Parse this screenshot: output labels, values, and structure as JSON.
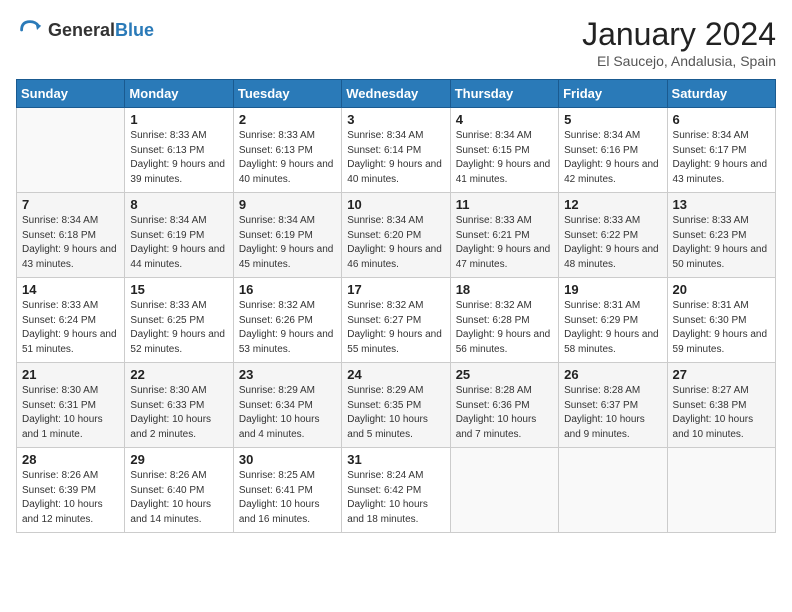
{
  "header": {
    "logo_general": "General",
    "logo_blue": "Blue",
    "month_title": "January 2024",
    "location": "El Saucejo, Andalusia, Spain"
  },
  "weekdays": [
    "Sunday",
    "Monday",
    "Tuesday",
    "Wednesday",
    "Thursday",
    "Friday",
    "Saturday"
  ],
  "weeks": [
    [
      {
        "day": "",
        "sunrise": "",
        "sunset": "",
        "daylight": ""
      },
      {
        "day": "1",
        "sunrise": "Sunrise: 8:33 AM",
        "sunset": "Sunset: 6:13 PM",
        "daylight": "Daylight: 9 hours and 39 minutes."
      },
      {
        "day": "2",
        "sunrise": "Sunrise: 8:33 AM",
        "sunset": "Sunset: 6:13 PM",
        "daylight": "Daylight: 9 hours and 40 minutes."
      },
      {
        "day": "3",
        "sunrise": "Sunrise: 8:34 AM",
        "sunset": "Sunset: 6:14 PM",
        "daylight": "Daylight: 9 hours and 40 minutes."
      },
      {
        "day": "4",
        "sunrise": "Sunrise: 8:34 AM",
        "sunset": "Sunset: 6:15 PM",
        "daylight": "Daylight: 9 hours and 41 minutes."
      },
      {
        "day": "5",
        "sunrise": "Sunrise: 8:34 AM",
        "sunset": "Sunset: 6:16 PM",
        "daylight": "Daylight: 9 hours and 42 minutes."
      },
      {
        "day": "6",
        "sunrise": "Sunrise: 8:34 AM",
        "sunset": "Sunset: 6:17 PM",
        "daylight": "Daylight: 9 hours and 43 minutes."
      }
    ],
    [
      {
        "day": "7",
        "sunrise": "Sunrise: 8:34 AM",
        "sunset": "Sunset: 6:18 PM",
        "daylight": "Daylight: 9 hours and 43 minutes."
      },
      {
        "day": "8",
        "sunrise": "Sunrise: 8:34 AM",
        "sunset": "Sunset: 6:19 PM",
        "daylight": "Daylight: 9 hours and 44 minutes."
      },
      {
        "day": "9",
        "sunrise": "Sunrise: 8:34 AM",
        "sunset": "Sunset: 6:19 PM",
        "daylight": "Daylight: 9 hours and 45 minutes."
      },
      {
        "day": "10",
        "sunrise": "Sunrise: 8:34 AM",
        "sunset": "Sunset: 6:20 PM",
        "daylight": "Daylight: 9 hours and 46 minutes."
      },
      {
        "day": "11",
        "sunrise": "Sunrise: 8:33 AM",
        "sunset": "Sunset: 6:21 PM",
        "daylight": "Daylight: 9 hours and 47 minutes."
      },
      {
        "day": "12",
        "sunrise": "Sunrise: 8:33 AM",
        "sunset": "Sunset: 6:22 PM",
        "daylight": "Daylight: 9 hours and 48 minutes."
      },
      {
        "day": "13",
        "sunrise": "Sunrise: 8:33 AM",
        "sunset": "Sunset: 6:23 PM",
        "daylight": "Daylight: 9 hours and 50 minutes."
      }
    ],
    [
      {
        "day": "14",
        "sunrise": "Sunrise: 8:33 AM",
        "sunset": "Sunset: 6:24 PM",
        "daylight": "Daylight: 9 hours and 51 minutes."
      },
      {
        "day": "15",
        "sunrise": "Sunrise: 8:33 AM",
        "sunset": "Sunset: 6:25 PM",
        "daylight": "Daylight: 9 hours and 52 minutes."
      },
      {
        "day": "16",
        "sunrise": "Sunrise: 8:32 AM",
        "sunset": "Sunset: 6:26 PM",
        "daylight": "Daylight: 9 hours and 53 minutes."
      },
      {
        "day": "17",
        "sunrise": "Sunrise: 8:32 AM",
        "sunset": "Sunset: 6:27 PM",
        "daylight": "Daylight: 9 hours and 55 minutes."
      },
      {
        "day": "18",
        "sunrise": "Sunrise: 8:32 AM",
        "sunset": "Sunset: 6:28 PM",
        "daylight": "Daylight: 9 hours and 56 minutes."
      },
      {
        "day": "19",
        "sunrise": "Sunrise: 8:31 AM",
        "sunset": "Sunset: 6:29 PM",
        "daylight": "Daylight: 9 hours and 58 minutes."
      },
      {
        "day": "20",
        "sunrise": "Sunrise: 8:31 AM",
        "sunset": "Sunset: 6:30 PM",
        "daylight": "Daylight: 9 hours and 59 minutes."
      }
    ],
    [
      {
        "day": "21",
        "sunrise": "Sunrise: 8:30 AM",
        "sunset": "Sunset: 6:31 PM",
        "daylight": "Daylight: 10 hours and 1 minute."
      },
      {
        "day": "22",
        "sunrise": "Sunrise: 8:30 AM",
        "sunset": "Sunset: 6:33 PM",
        "daylight": "Daylight: 10 hours and 2 minutes."
      },
      {
        "day": "23",
        "sunrise": "Sunrise: 8:29 AM",
        "sunset": "Sunset: 6:34 PM",
        "daylight": "Daylight: 10 hours and 4 minutes."
      },
      {
        "day": "24",
        "sunrise": "Sunrise: 8:29 AM",
        "sunset": "Sunset: 6:35 PM",
        "daylight": "Daylight: 10 hours and 5 minutes."
      },
      {
        "day": "25",
        "sunrise": "Sunrise: 8:28 AM",
        "sunset": "Sunset: 6:36 PM",
        "daylight": "Daylight: 10 hours and 7 minutes."
      },
      {
        "day": "26",
        "sunrise": "Sunrise: 8:28 AM",
        "sunset": "Sunset: 6:37 PM",
        "daylight": "Daylight: 10 hours and 9 minutes."
      },
      {
        "day": "27",
        "sunrise": "Sunrise: 8:27 AM",
        "sunset": "Sunset: 6:38 PM",
        "daylight": "Daylight: 10 hours and 10 minutes."
      }
    ],
    [
      {
        "day": "28",
        "sunrise": "Sunrise: 8:26 AM",
        "sunset": "Sunset: 6:39 PM",
        "daylight": "Daylight: 10 hours and 12 minutes."
      },
      {
        "day": "29",
        "sunrise": "Sunrise: 8:26 AM",
        "sunset": "Sunset: 6:40 PM",
        "daylight": "Daylight: 10 hours and 14 minutes."
      },
      {
        "day": "30",
        "sunrise": "Sunrise: 8:25 AM",
        "sunset": "Sunset: 6:41 PM",
        "daylight": "Daylight: 10 hours and 16 minutes."
      },
      {
        "day": "31",
        "sunrise": "Sunrise: 8:24 AM",
        "sunset": "Sunset: 6:42 PM",
        "daylight": "Daylight: 10 hours and 18 minutes."
      },
      {
        "day": "",
        "sunrise": "",
        "sunset": "",
        "daylight": ""
      },
      {
        "day": "",
        "sunrise": "",
        "sunset": "",
        "daylight": ""
      },
      {
        "day": "",
        "sunrise": "",
        "sunset": "",
        "daylight": ""
      }
    ]
  ]
}
